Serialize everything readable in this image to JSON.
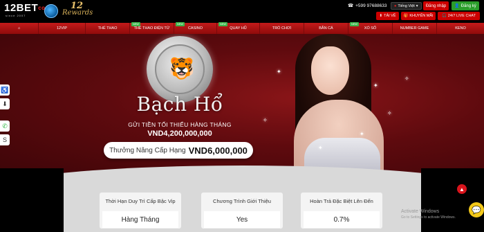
{
  "header": {
    "logo_text": "12BET",
    "logo_suffix": "com",
    "logo_sub": "since 2007",
    "rewards_num": "12",
    "rewards_word": "Rewards",
    "phone": "+599 97688633",
    "language": "Tiếng Việt",
    "login_label": "Đăng nhập",
    "register_label": "Đăng ký",
    "download_label": "TẢI VỀ",
    "promotions_label": "KHUYẾN MÃI",
    "live_chat_label": "24/7 LIVE CHAT"
  },
  "nav": {
    "items": [
      {
        "label": "⌂",
        "badge": ""
      },
      {
        "label": "12VIP",
        "badge": ""
      },
      {
        "label": "THỂ THAO",
        "badge": ""
      },
      {
        "label": "THỂ THAO ĐIỆN TỬ",
        "badge": "NEW"
      },
      {
        "label": "CASINO",
        "badge": "NEW"
      },
      {
        "label": "QUAY HŨ",
        "badge": "NEW"
      },
      {
        "label": "TRÒ CHƠI",
        "badge": ""
      },
      {
        "label": "BẮN CÁ",
        "badge": ""
      },
      {
        "label": "XỔ SỐ",
        "badge": "NEW"
      },
      {
        "label": "NUMBER GAME",
        "badge": ""
      },
      {
        "label": "KENO",
        "badge": ""
      }
    ]
  },
  "hero": {
    "title": "Bạch Hổ",
    "subtitle": "GỬI TIỀN TỐI THIỂU HÀNG THÁNG",
    "min_deposit": "VND4,200,000,000",
    "upgrade_label": "Thưởng Nâng Cấp Hạng",
    "upgrade_value": "VND6,000,000"
  },
  "cards": [
    {
      "heading": "Thời Hạn Duy Trì Cấp Bậc Vip",
      "value": "Hàng Tháng"
    },
    {
      "heading": "Chương Trình Giới Thiệu",
      "value": "Yes"
    },
    {
      "heading": "Hoàn Trả Đặc Biệt Lên Đến",
      "value": "0.7%"
    }
  ],
  "watermark": {
    "line1": "Activate Windows",
    "line2": "Go to Settings to activate Windows."
  },
  "colors": {
    "nav_red": "#c41a1a",
    "login_red": "#cc0000",
    "register_green": "#2a9d2a",
    "hero_maroon": "#5e0a0e"
  }
}
